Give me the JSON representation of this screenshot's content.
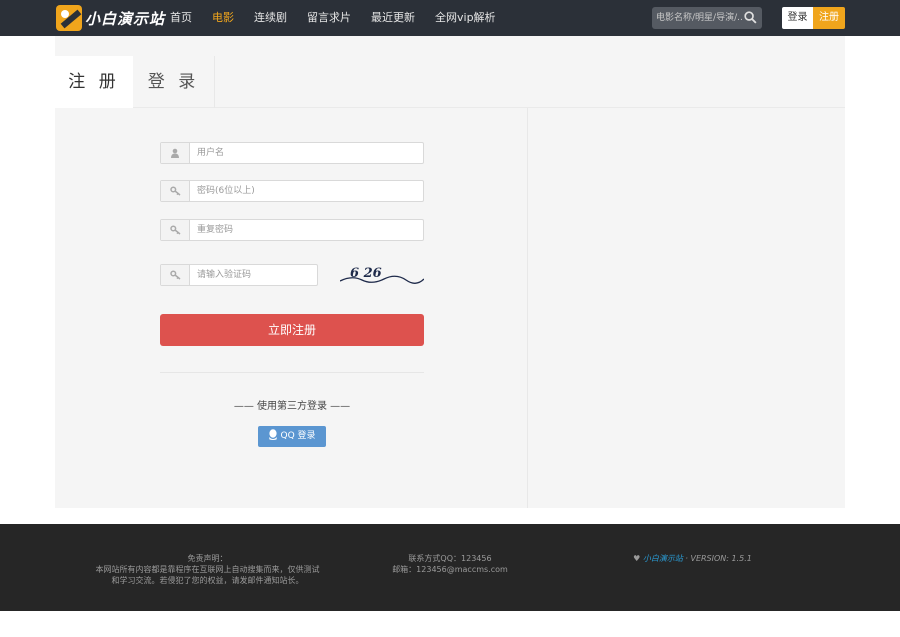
{
  "header": {
    "logo_text": "小白演示站",
    "nav": [
      {
        "label": "首页",
        "active": false
      },
      {
        "label": "电影",
        "active": true
      },
      {
        "label": "连续剧",
        "active": false
      },
      {
        "label": "留言求片",
        "active": false
      },
      {
        "label": "最近更新",
        "active": false
      },
      {
        "label": "全网vip解析",
        "active": false
      }
    ],
    "search_placeholder": "电影名称/明星/导演/...",
    "login_label": "登录",
    "register_label": "注册",
    "accent_color": "#f0a51c",
    "bg_color": "#2b3038"
  },
  "tabs": {
    "register": "注 册",
    "login": "登 录"
  },
  "form": {
    "username_placeholder": "用户名",
    "password_placeholder": "密码(6位以上)",
    "repeat_placeholder": "重复密码",
    "captcha_placeholder": "请输入验证码",
    "captcha_text": "6 26",
    "submit_label": "立即注册",
    "submit_color": "#dd524e",
    "third_party_text": "—— 使用第三方登录 ——",
    "qq_label": "QQ 登录",
    "qq_color": "#5b96d1"
  },
  "footer": {
    "disclaimer_title": "免责声明：",
    "disclaimer_line1": "本网站所有内容都是靠程序在互联网上自动搜集而来，仅供测试",
    "disclaimer_line2": "和学习交流。若侵犯了您的权益，请发邮件通知站长。",
    "contact_qq": "联系方式QQ：123456",
    "contact_email": "邮箱：123456@maccms.com",
    "heart": "♥",
    "brand": "小白演示站",
    "version": " · VERSION: 1.5.1"
  }
}
